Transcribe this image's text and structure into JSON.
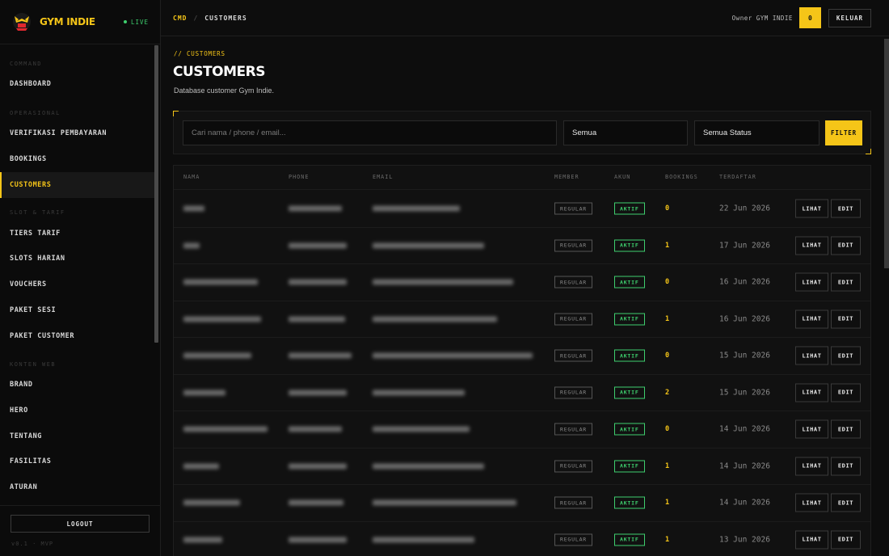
{
  "brand": {
    "name": "GYM INDIE",
    "status": "LIVE",
    "accent": "#f5c518",
    "live_color": "#3ecf6e"
  },
  "sidebar": {
    "sections": [
      {
        "title": "COMMAND",
        "items": [
          "DASHBOARD"
        ]
      },
      {
        "title": "OPERASIONAL",
        "items": [
          "VERIFIKASI PEMBAYARAN",
          "BOOKINGS",
          "CUSTOMERS"
        ]
      },
      {
        "title": "SLOT & TARIF",
        "items": [
          "TIERS TARIF",
          "SLOTS HARIAN",
          "VOUCHERS",
          "PAKET SESI",
          "PAKET CUSTOMER"
        ]
      },
      {
        "title": "KONTEN WEB",
        "items": [
          "BRAND",
          "HERO",
          "TENTANG",
          "FASILITAS",
          "ATURAN"
        ]
      }
    ],
    "active_item": "CUSTOMERS",
    "logout_label": "LOGOUT",
    "version": "v0.1 · MVP"
  },
  "topbar": {
    "crumb_root": "CMD",
    "crumb_sep": "/",
    "crumb_current": "CUSTOMERS",
    "owner_label": "Owner GYM INDIE",
    "notif_count": "0",
    "logout_label": "KELUAR"
  },
  "page": {
    "eyebrow": "// CUSTOMERS",
    "title": "CUSTOMERS",
    "subtitle": "Database customer Gym Indie."
  },
  "filter": {
    "search_placeholder": "Cari nama / phone / email...",
    "member_value": "Semua",
    "status_value": "Semua Status",
    "button_label": "FILTER"
  },
  "table": {
    "columns": [
      "NAMA",
      "PHONE",
      "EMAIL",
      "MEMBER",
      "AKUN",
      "BOOKINGS",
      "TERDAFTAR"
    ],
    "actions": {
      "view": "LIHAT",
      "edit": "EDIT"
    },
    "rows": [
      {
        "member": "REGULAR",
        "akun": "AKTIF",
        "bookings": "0",
        "terdaftar": "22 Jun 2026"
      },
      {
        "member": "REGULAR",
        "akun": "AKTIF",
        "bookings": "1",
        "terdaftar": "17 Jun 2026"
      },
      {
        "member": "REGULAR",
        "akun": "AKTIF",
        "bookings": "0",
        "terdaftar": "16 Jun 2026"
      },
      {
        "member": "REGULAR",
        "akun": "AKTIF",
        "bookings": "1",
        "terdaftar": "16 Jun 2026"
      },
      {
        "member": "REGULAR",
        "akun": "AKTIF",
        "bookings": "0",
        "terdaftar": "15 Jun 2026"
      },
      {
        "member": "REGULAR",
        "akun": "AKTIF",
        "bookings": "2",
        "terdaftar": "15 Jun 2026"
      },
      {
        "member": "REGULAR",
        "akun": "AKTIF",
        "bookings": "0",
        "terdaftar": "14 Jun 2026"
      },
      {
        "member": "REGULAR",
        "akun": "AKTIF",
        "bookings": "1",
        "terdaftar": "14 Jun 2026"
      },
      {
        "member": "REGULAR",
        "akun": "AKTIF",
        "bookings": "1",
        "terdaftar": "14 Jun 2026"
      },
      {
        "member": "REGULAR",
        "akun": "AKTIF",
        "bookings": "1",
        "terdaftar": "13 Jun 2026"
      }
    ]
  }
}
